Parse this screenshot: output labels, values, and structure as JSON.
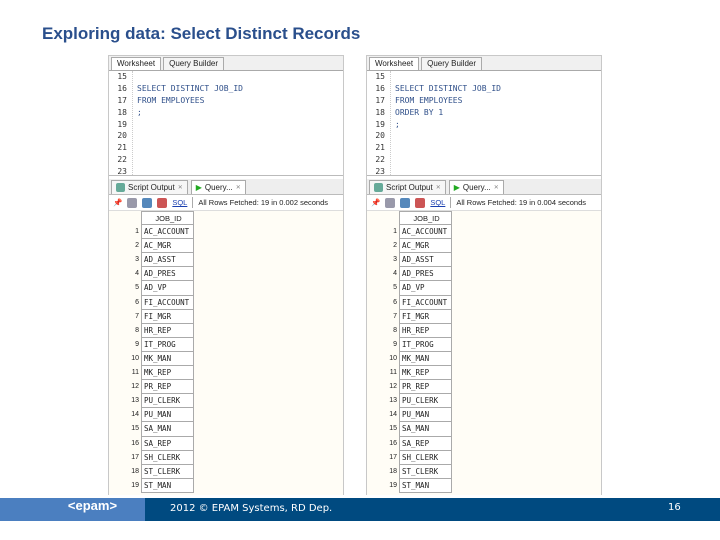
{
  "slide": {
    "title": "Exploring data: Select Distinct Records",
    "footer": "2012 © EPAM Systems, RD Dep.",
    "page_number": "16",
    "logo": "<epam>"
  },
  "panels": [
    {
      "tabs": [
        "Worksheet",
        "Query Builder"
      ],
      "lines": [
        {
          "n": "15",
          "t": ""
        },
        {
          "n": "16",
          "t": "SELECT DISTINCT JOB_ID"
        },
        {
          "n": "17",
          "t": "FROM EMPLOYEES"
        },
        {
          "n": "18",
          "t": ";"
        },
        {
          "n": "19",
          "t": ""
        },
        {
          "n": "20",
          "t": ""
        },
        {
          "n": "21",
          "t": ""
        },
        {
          "n": "22",
          "t": ""
        },
        {
          "n": "23",
          "t": ""
        }
      ],
      "result_tabs": [
        "Script Output",
        "Query..."
      ],
      "sql_link": "SQL",
      "status": "All Rows Fetched: 19 in 0.002 seconds",
      "column": "JOB_ID",
      "rows": [
        "AC_ACCOUNT",
        "AC_MGR",
        "AD_ASST",
        "AD_PRES",
        "AD_VP",
        "FI_ACCOUNT",
        "FI_MGR",
        "HR_REP",
        "IT_PROG",
        "MK_MAN",
        "MK_REP",
        "PR_REP",
        "PU_CLERK",
        "PU_MAN",
        "SA_MAN",
        "SA_REP",
        "SH_CLERK",
        "ST_CLERK",
        "ST_MAN"
      ]
    },
    {
      "tabs": [
        "Worksheet",
        "Query Builder"
      ],
      "lines": [
        {
          "n": "15",
          "t": ""
        },
        {
          "n": "16",
          "t": "SELECT DISTINCT JOB_ID"
        },
        {
          "n": "17",
          "t": "FROM EMPLOYEES"
        },
        {
          "n": "18",
          "t": "ORDER BY 1"
        },
        {
          "n": "19",
          "t": ";"
        },
        {
          "n": "20",
          "t": ""
        },
        {
          "n": "21",
          "t": ""
        },
        {
          "n": "22",
          "t": ""
        },
        {
          "n": "23",
          "t": ""
        }
      ],
      "result_tabs": [
        "Script Output",
        "Query..."
      ],
      "sql_link": "SQL",
      "status": "All Rows Fetched: 19 in 0.004 seconds",
      "column": "JOB_ID",
      "rows": [
        "AC_ACCOUNT",
        "AC_MGR",
        "AD_ASST",
        "AD_PRES",
        "AD_VP",
        "FI_ACCOUNT",
        "FI_MGR",
        "HR_REP",
        "IT_PROG",
        "MK_MAN",
        "MK_REP",
        "PR_REP",
        "PU_CLERK",
        "PU_MAN",
        "SA_MAN",
        "SA_REP",
        "SH_CLERK",
        "ST_CLERK",
        "ST_MAN"
      ]
    }
  ]
}
